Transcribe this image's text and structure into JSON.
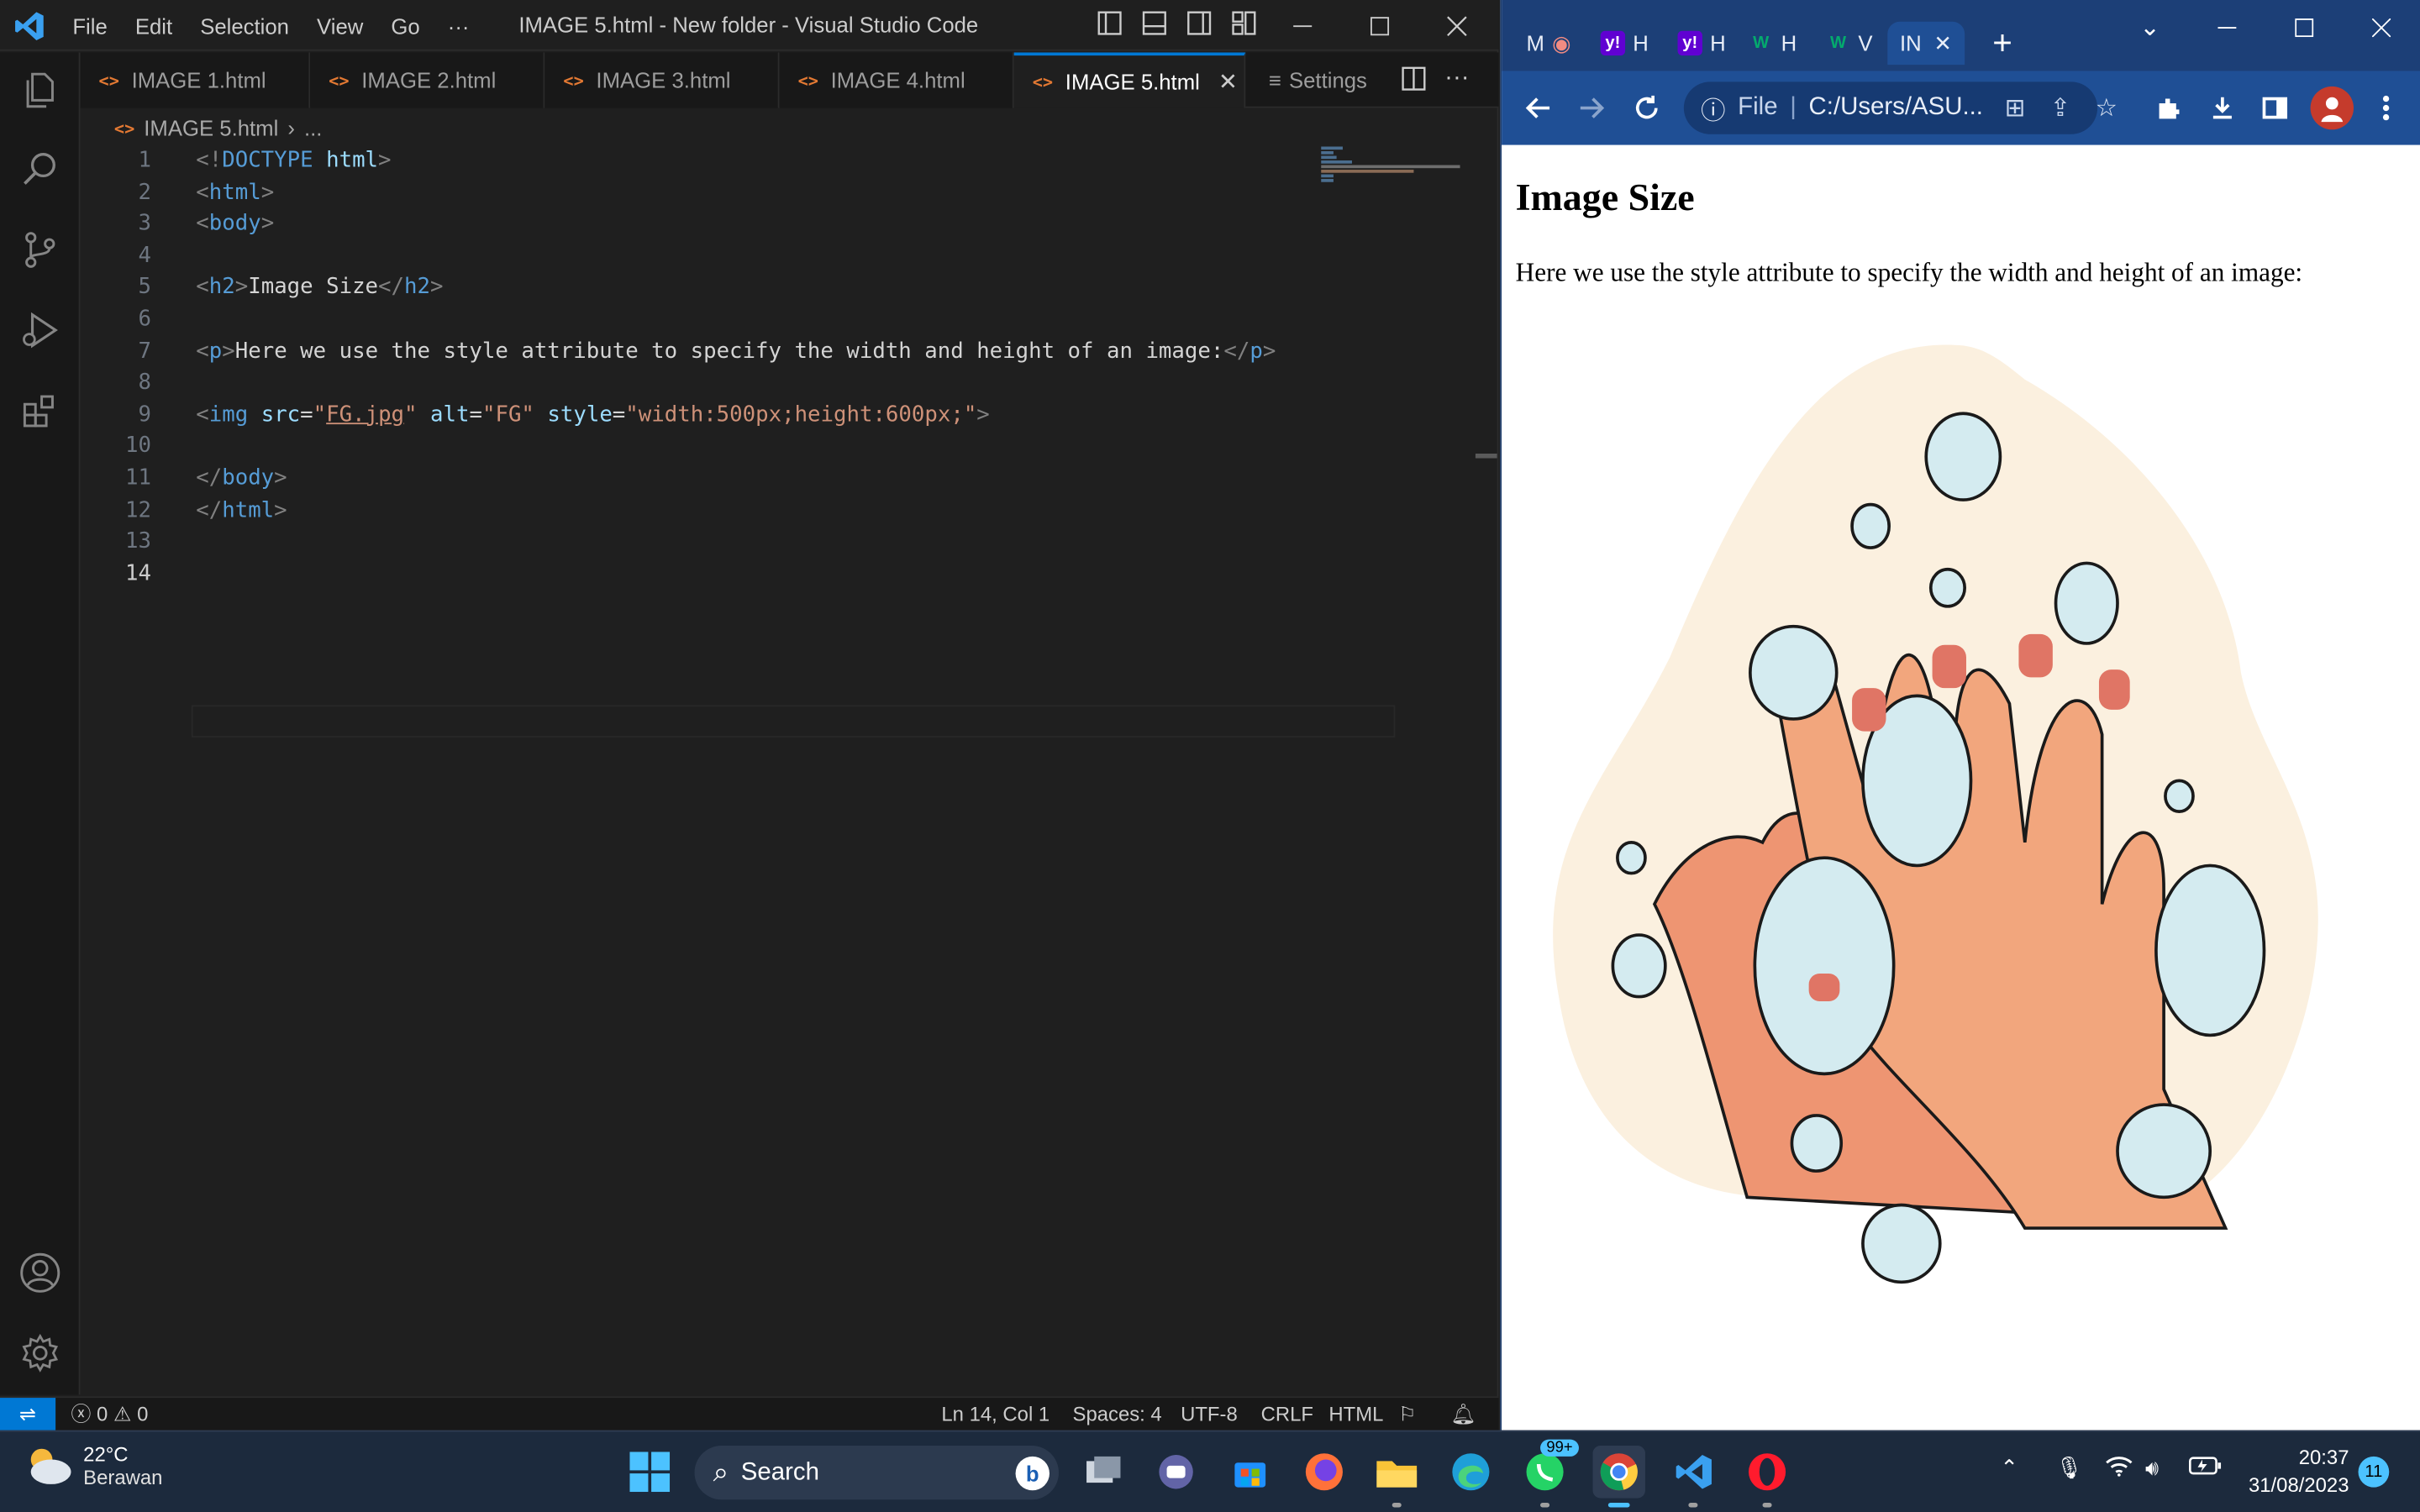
{
  "vscode": {
    "window_title": "IMAGE 5.html - New folder - Visual Studio Code",
    "menu": [
      "File",
      "Edit",
      "Selection",
      "View",
      "Go",
      "···"
    ],
    "tabs": [
      {
        "label": "IMAGE 1.html"
      },
      {
        "label": "IMAGE 2.html"
      },
      {
        "label": "IMAGE 3.html"
      },
      {
        "label": "IMAGE 4.html"
      },
      {
        "label": "IMAGE 5.html",
        "active": true
      }
    ],
    "settings_tab": "Settings",
    "breadcrumb": {
      "file": "IMAGE 5.html",
      "rest": "..."
    },
    "line_numbers": [
      "1",
      "2",
      "3",
      "4",
      "5",
      "6",
      "7",
      "8",
      "9",
      "10",
      "11",
      "12",
      "13",
      "14"
    ],
    "code": {
      "l1": {
        "a": "<!",
        "b": "DOCTYPE",
        "c": " html",
        "d": ">"
      },
      "l2": {
        "a": "<",
        "b": "html",
        "c": ">"
      },
      "l3": {
        "a": "<",
        "b": "body",
        "c": ">"
      },
      "l5": {
        "a": "<",
        "b": "h2",
        "c": ">",
        "d": "Image Size",
        "e": "</",
        "f": "h2",
        "g": ">"
      },
      "l7": {
        "a": "<",
        "b": "p",
        "c": ">",
        "d": "Here we use the style attribute to specify the width and height of an image:",
        "e": "</",
        "f": "p",
        "g": ">"
      },
      "l9": {
        "a": "<",
        "b": "img",
        "c": " src",
        "d": "=",
        "e": "\"",
        "f": "FG.jpg",
        "g": "\"",
        "h": " alt",
        "i": "=",
        "j": "\"FG\"",
        "k": " style",
        "l": "=",
        "m": "\"width:500px;height:600px;\"",
        "n": ">"
      },
      "l11": {
        "a": "</",
        "b": "body",
        "c": ">"
      },
      "l12": {
        "a": "</",
        "b": "html",
        "c": ">"
      }
    },
    "status": {
      "errors": "0",
      "warnings": "0",
      "position": "Ln 14, Col 1",
      "spaces": "Spaces: 4",
      "encoding": "UTF-8",
      "eol": "CRLF",
      "language": "HTML"
    },
    "colors": {
      "accent": "#0078d4",
      "background": "#1f1f1f"
    }
  },
  "chrome": {
    "tabs": [
      "M",
      "H",
      "H",
      "H",
      "V",
      "IN"
    ],
    "omnibox_scheme": "File",
    "omnibox_url": "C:/Users/ASU...",
    "page": {
      "heading": "Image Size",
      "paragraph": "Here we use the style attribute to specify the width and height of an image:"
    },
    "colors": {
      "frame": "#1c3f77",
      "toolbar": "#1f4f95"
    }
  },
  "taskbar": {
    "weather_temp": "22°C",
    "weather_desc": "Berawan",
    "search_label": "Search",
    "whatsapp_badge": "99+",
    "time": "20:37",
    "date": "31/08/2023",
    "notifications": "11"
  }
}
